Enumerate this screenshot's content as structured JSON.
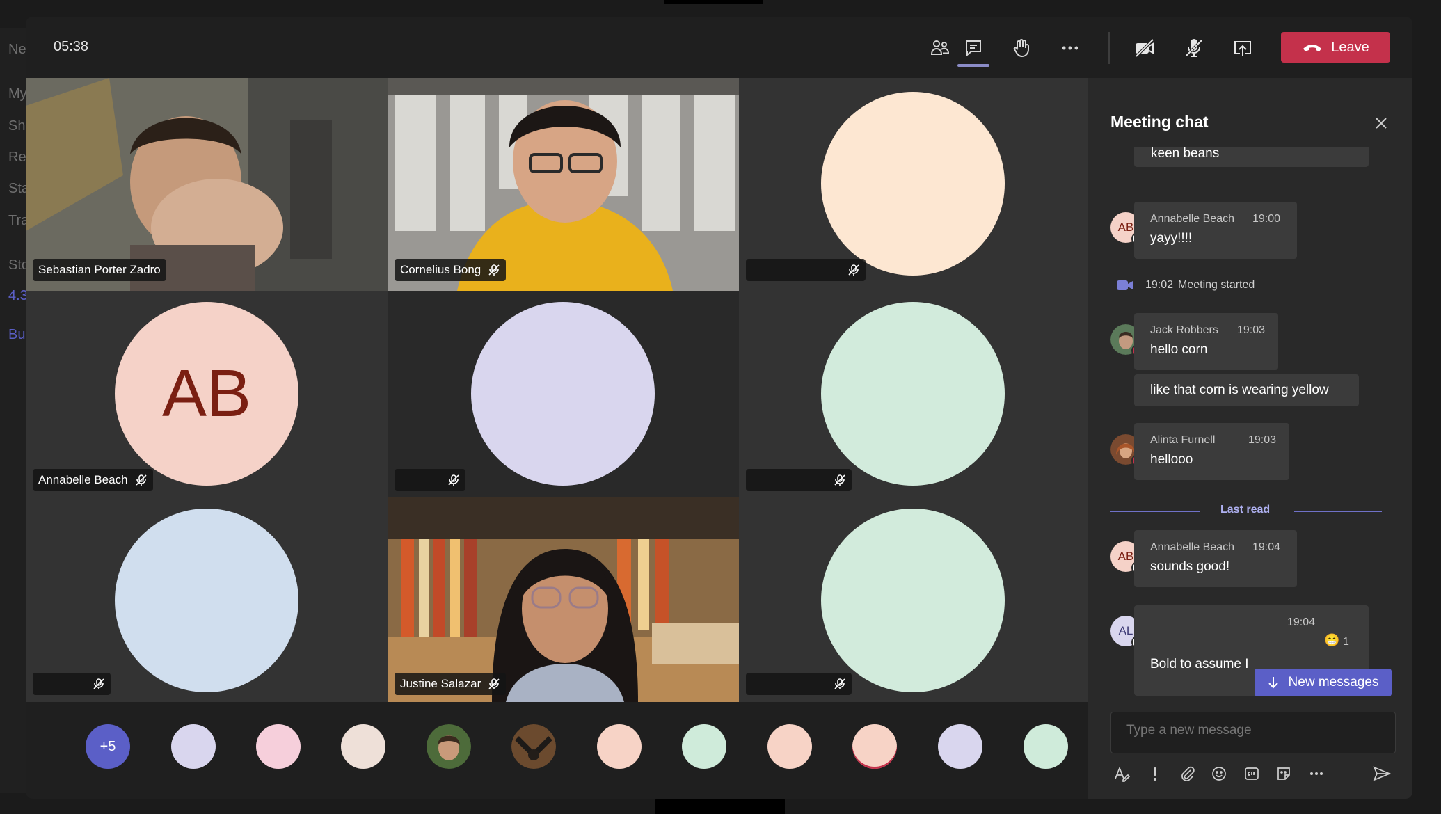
{
  "background": {
    "sidebar_letters": [
      "Ne",
      "My",
      "Sh",
      "Re",
      "Sta",
      "Tra",
      "Sto",
      "4.3",
      "Bu"
    ]
  },
  "topbar": {
    "timer": "05:38",
    "icons": [
      "people-icon",
      "chat-icon",
      "raise-hand-icon",
      "more-icon",
      "camera-off-icon",
      "mic-off-icon",
      "share-screen-icon"
    ],
    "leave_label": "Leave",
    "accent": "#c4314b"
  },
  "tiles": [
    {
      "name": "Sebastian Porter Zadro",
      "type": "video",
      "muted": false
    },
    {
      "name": "Cornelius Bong",
      "type": "video",
      "muted": true
    },
    {
      "name": "",
      "type": "avatar",
      "color": "#fde7d2",
      "muted": true
    },
    {
      "name": "Annabelle Beach",
      "type": "avatar",
      "initials": "AB",
      "color": "#f5d2c8",
      "muted": true
    },
    {
      "name": "",
      "type": "avatar",
      "color": "#d9d6ee",
      "muted": true
    },
    {
      "name": "",
      "type": "avatar",
      "color": "#d2ebdc",
      "muted": true
    },
    {
      "name": "",
      "type": "avatar",
      "color": "#d0deee",
      "muted": true
    },
    {
      "name": "Justine Salazar",
      "type": "video",
      "muted": true
    },
    {
      "name": "",
      "type": "avatar",
      "color": "#d2ebdc",
      "muted": true
    }
  ],
  "strip": {
    "more_count": "+5",
    "avatars": [
      "#d9d6ee",
      "#f6cfdb",
      "#eee0d8",
      "photo",
      "photo",
      "#f7d3c6",
      "#cfebda",
      "#f7d3c6",
      "#f7d3c6",
      "#d9d6ee",
      "#cfebda"
    ]
  },
  "chat": {
    "title": "Meeting chat",
    "partial_message": "keen beans",
    "messages": [
      {
        "sender": "Annabelle Beach",
        "time": "19:00",
        "text": "yayy!!!!",
        "initials": "AB",
        "avatar_color": "#f5d2c8"
      },
      {
        "event_time": "19:02",
        "event_text": "Meeting started"
      },
      {
        "sender": "Jack Robbers",
        "time": "19:03",
        "text": "hello corn",
        "followup": "like that corn is wearing yellow"
      },
      {
        "sender": "Alinta Furnell",
        "time": "19:03",
        "text": "hellooo"
      },
      {
        "sender": "Annabelle Beach",
        "time": "19:04",
        "text": "sounds good!",
        "initials": "AB",
        "avatar_color": "#f5d2c8"
      },
      {
        "sender": "",
        "time": "19:04",
        "text": "Bold to assume I",
        "initials": "AL",
        "avatar_color": "#d9d6ee",
        "reaction": "😁",
        "reaction_count": "1"
      }
    ],
    "last_read_label": "Last read",
    "new_messages_label": "New messages",
    "compose_placeholder": "Type a new message",
    "tools": [
      "format-icon",
      "important-icon",
      "attach-icon",
      "emoji-icon",
      "gif-icon",
      "sticker-icon",
      "more-options-icon",
      "send-icon"
    ]
  }
}
